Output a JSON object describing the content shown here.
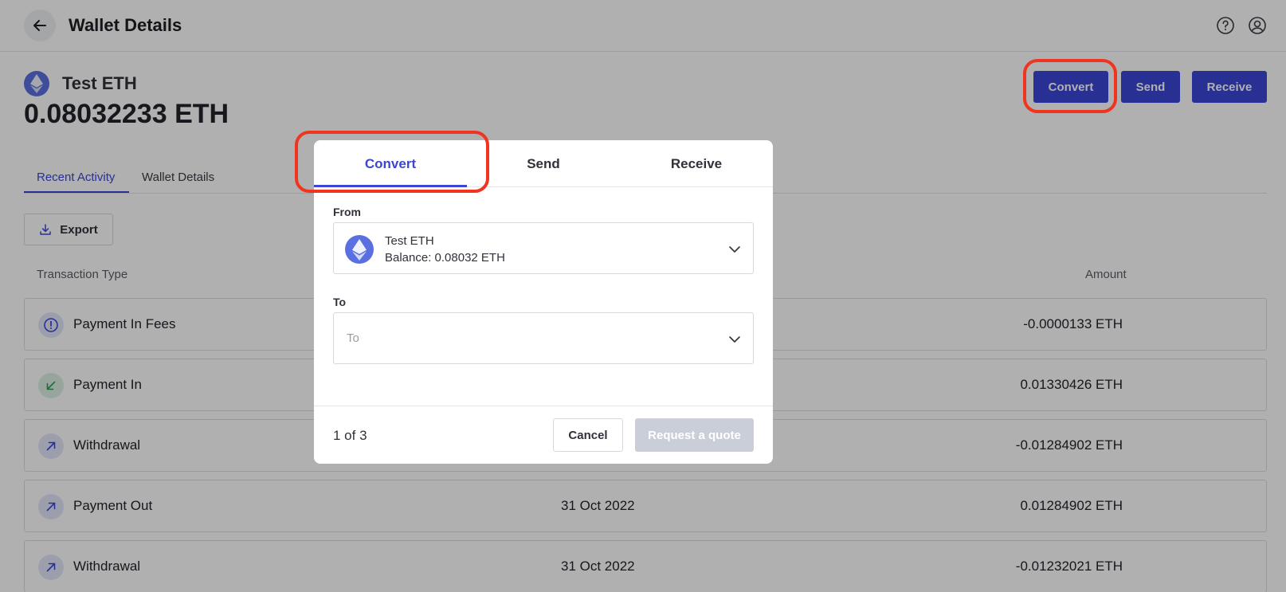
{
  "header": {
    "title": "Wallet Details",
    "help_icon": "help-circle-icon",
    "account_icon": "user-circle-icon"
  },
  "asset": {
    "name": "Test ETH",
    "balance": "0.08032233 ETH"
  },
  "actions": {
    "convert": "Convert",
    "send": "Send",
    "receive": "Receive"
  },
  "tabs": [
    {
      "label": "Recent Activity",
      "active": true
    },
    {
      "label": "Wallet Details",
      "active": false
    }
  ],
  "export_label": "Export",
  "table": {
    "columns": {
      "type": "Transaction Type",
      "amount": "Amount"
    },
    "rows": [
      {
        "type": "Payment In Fees",
        "date": "",
        "amount": "-0.0000133 ETH",
        "icon": "alert-circle-icon"
      },
      {
        "type": "Payment In",
        "date": "",
        "amount": "0.01330426 ETH",
        "icon": "arrow-down-left-icon"
      },
      {
        "type": "Withdrawal",
        "date": "",
        "amount": "-0.01284902 ETH",
        "icon": "arrow-up-right-icon"
      },
      {
        "type": "Payment Out",
        "date": "31 Oct 2022",
        "amount": "0.01284902 ETH",
        "icon": "arrow-up-right-icon"
      },
      {
        "type": "Withdrawal",
        "date": "31 Oct 2022",
        "amount": "-0.01232021 ETH",
        "icon": "arrow-up-right-icon"
      }
    ]
  },
  "modal": {
    "tabs": [
      {
        "label": "Convert",
        "active": true
      },
      {
        "label": "Send",
        "active": false
      },
      {
        "label": "Receive",
        "active": false
      }
    ],
    "from_label": "From",
    "from": {
      "name": "Test ETH",
      "balance": "Balance: 0.08032 ETH"
    },
    "to_label": "To",
    "to_placeholder": "To",
    "step": "1 of 3",
    "cancel": "Cancel",
    "request_quote": "Request a quote"
  },
  "colors": {
    "accent": "#3a46d6",
    "highlight": "#f0341f"
  }
}
